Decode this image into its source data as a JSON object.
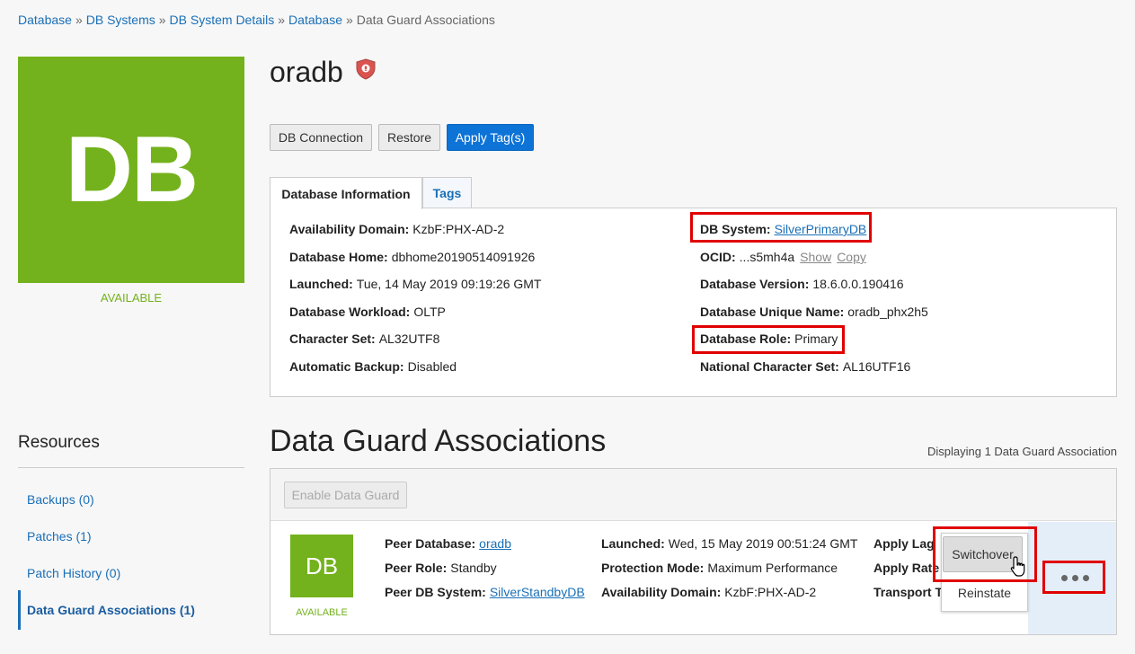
{
  "breadcrumb": {
    "items": [
      "Database",
      "DB Systems",
      "DB System Details",
      "Database"
    ],
    "current": "Data Guard Associations",
    "separator": "»"
  },
  "database": {
    "tile_label": "DB",
    "status": "AVAILABLE",
    "name": "oradb",
    "icon": "security-shield-icon"
  },
  "actions": {
    "db_connection": "DB Connection",
    "restore": "Restore",
    "apply_tags": "Apply Tag(s)"
  },
  "tabs": {
    "info": "Database Information",
    "tags": "Tags"
  },
  "info": {
    "left": [
      {
        "label": "Availability Domain:",
        "value": "KzbF:PHX-AD-2"
      },
      {
        "label": "Database Home:",
        "value": "dbhome20190514091926"
      },
      {
        "label": "Launched:",
        "value": "Tue, 14 May 2019 09:19:26 GMT"
      },
      {
        "label": "Database Workload:",
        "value": "OLTP"
      },
      {
        "label": "Character Set:",
        "value": "AL32UTF8"
      },
      {
        "label": "Automatic Backup:",
        "value": "Disabled"
      }
    ],
    "db_system_label": "DB System:",
    "db_system_value": "SilverPrimaryDB",
    "ocid_label": "OCID:",
    "ocid_value": "...s5mh4a",
    "ocid_show": "Show",
    "ocid_copy": "Copy",
    "version_label": "Database Version:",
    "version_value": "18.6.0.0.190416",
    "unique_label": "Database Unique Name:",
    "unique_value": "oradb_phx2h5",
    "role_label": "Database Role:",
    "role_value": "Primary",
    "ncs_label": "National Character Set:",
    "ncs_value": "AL16UTF16"
  },
  "resources": {
    "title": "Resources",
    "items": [
      "Backups (0)",
      "Patches (1)",
      "Patch History (0)",
      "Data Guard Associations (1)"
    ]
  },
  "dataguard": {
    "title": "Data Guard Associations",
    "count_text": "Displaying 1 Data Guard Association",
    "enable_button": "Enable Data Guard",
    "row": {
      "tile_label": "DB",
      "status": "AVAILABLE",
      "peer_db_label": "Peer Database:",
      "peer_db_value": "oradb",
      "peer_role_label": "Peer Role:",
      "peer_role_value": "Standby",
      "peer_dbsys_label": "Peer DB System:",
      "peer_dbsys_value": "SilverStandbyDB",
      "launched_label": "Launched:",
      "launched_value": "Wed, 15 May 2019 00:51:24 GMT",
      "protection_label": "Protection Mode:",
      "protection_value": "Maximum Performance",
      "ad_label": "Availability Domain:",
      "ad_value": "KzbF:PHX-AD-2",
      "apply_lag_label": "Apply Lag",
      "apply_rate_label": "Apply Rate",
      "transport_label": "Transport T"
    },
    "menu": {
      "switchover": "Switchover",
      "reinstate": "Reinstate"
    }
  },
  "colors": {
    "accent": "#1a6fb7",
    "available_green": "#73b21c",
    "primary_button": "#0d73d6",
    "highlight_red": "#e00000"
  }
}
